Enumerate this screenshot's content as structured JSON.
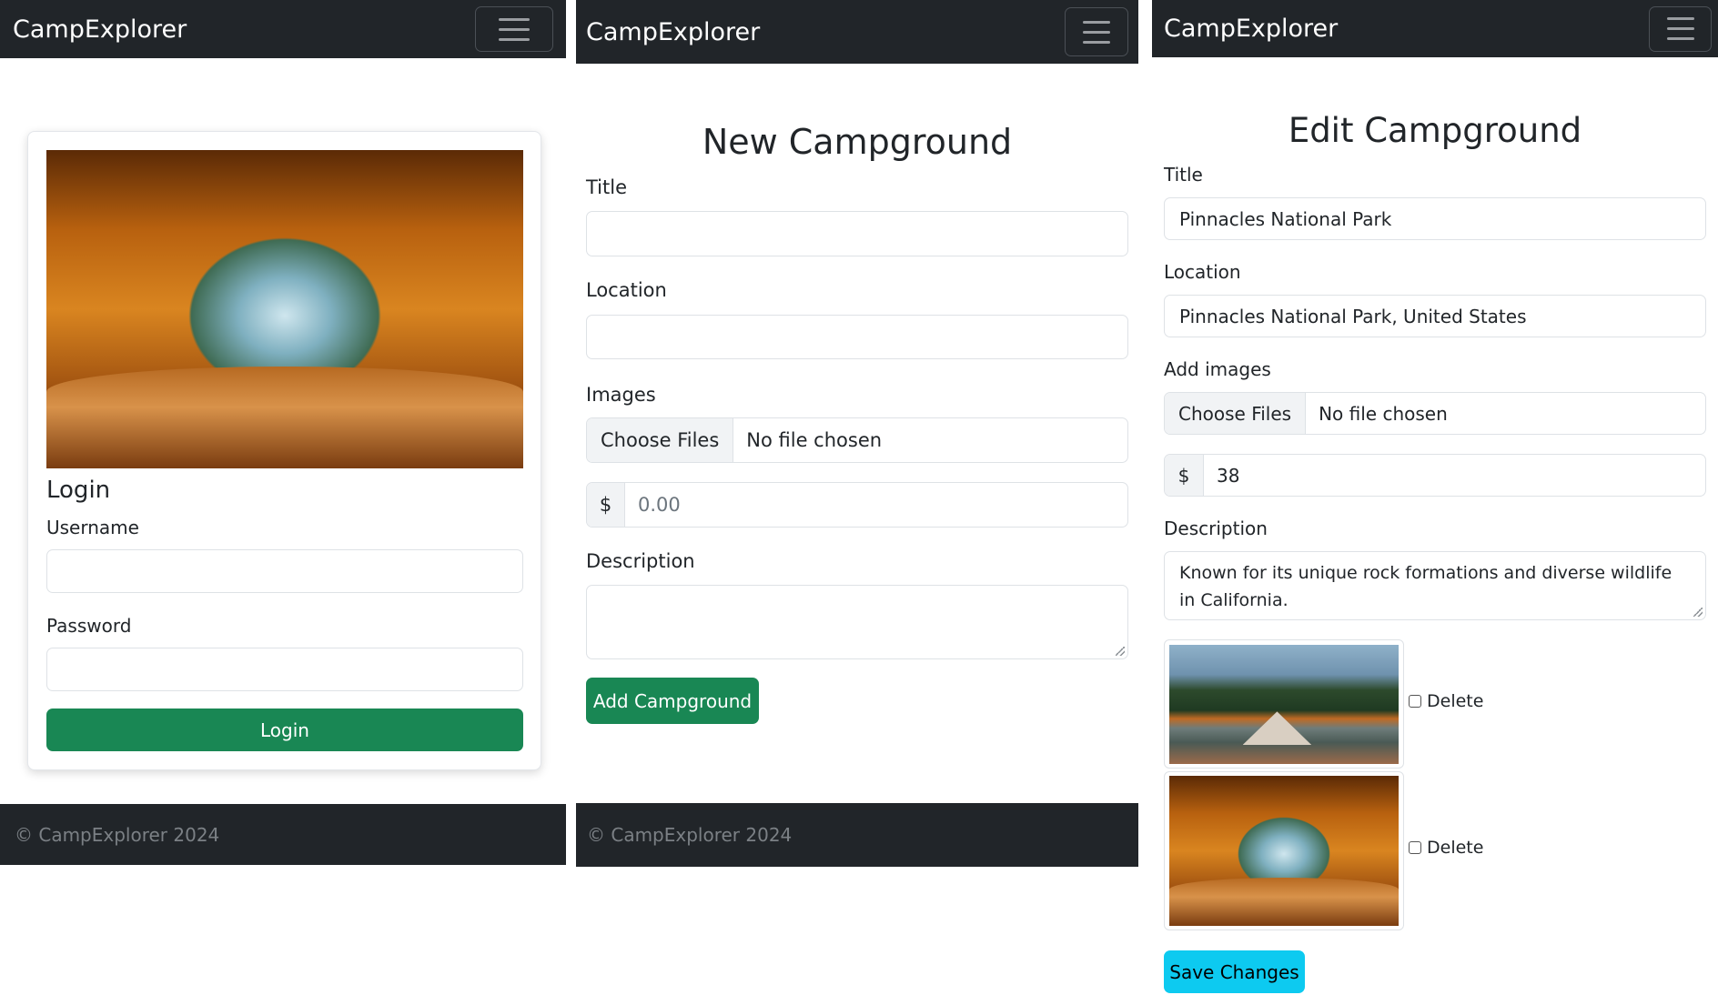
{
  "login_panel": {
    "brand": "CampExplorer",
    "heading": "Login",
    "username_label": "Username",
    "password_label": "Password",
    "login_button": "Login",
    "footer": "© CampExplorer 2024"
  },
  "new_panel": {
    "brand": "CampExplorer",
    "heading": "New Campground",
    "title_label": "Title",
    "location_label": "Location",
    "images_label": "Images",
    "choose_files": "Choose Files",
    "no_file": "No file chosen",
    "currency": "$",
    "price_placeholder": "0.00",
    "description_label": "Description",
    "submit_button": "Add Campground",
    "footer": "© CampExplorer 2024"
  },
  "edit_panel": {
    "brand": "CampExplorer",
    "heading": "Edit Campground",
    "title_label": "Title",
    "title_value": "Pinnacles National Park",
    "location_label": "Location",
    "location_value": "Pinnacles National Park, United States",
    "images_label": "Add images",
    "choose_files": "Choose Files",
    "no_file": "No file chosen",
    "currency": "$",
    "price_value": "38",
    "description_label": "Description",
    "description_value": "Known for its unique rock formations and diverse wildlife in California.",
    "delete_label": "Delete",
    "save_button": "Save Changes"
  },
  "colors": {
    "navbar": "#212529",
    "success": "#198754",
    "info": "#0dcaf0"
  }
}
